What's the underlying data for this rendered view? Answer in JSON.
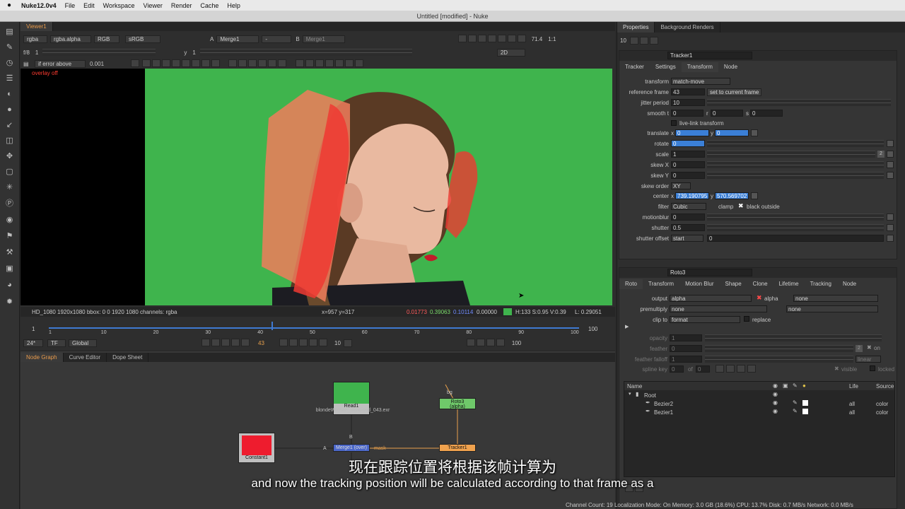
{
  "menubar": {
    "app": "Nuke12.0v4",
    "items": [
      "File",
      "Edit",
      "Workspace",
      "Viewer",
      "Render",
      "Cache",
      "Help"
    ]
  },
  "window_title": "Untitled [modified] - Nuke",
  "viewer": {
    "tab": "Viewer1",
    "channels": "rgba",
    "channel_alpha": "rgba.alpha",
    "display": "RGB",
    "colorspace": "sRGB",
    "input_a": "Merge1",
    "input_a_label": "A",
    "dash": "-",
    "input_b_label": "B",
    "input_b": "Merge1",
    "zoom": "71.4",
    "ratio": "1:1",
    "frame_label": "f/8",
    "frame_value": "1",
    "y_label": "y",
    "y_value": "1",
    "mode_2d": "2D",
    "error_mode": "if error above",
    "error_value": "0.001",
    "overlay": "overlay off",
    "status_format": "HD_1080 1920x1080  bbox: 0 0 1920 1080  channels: rgba",
    "status_xy": "x=957 y=317",
    "status_r": "0.01773",
    "status_g": "0.39063",
    "status_b": "0.10114",
    "status_a": "0.00000",
    "status_hsv": "H:133 S:0.95 V:0.39",
    "status_l": "L: 0.29051",
    "colors": {
      "green_screen": "#3fb44d",
      "roto_orange": "#e8745a",
      "roto_red": "#ee3a32"
    }
  },
  "timeline": {
    "start": "1",
    "end": "100",
    "end2": "100",
    "ticks": [
      "1",
      "10",
      "20",
      "30",
      "40",
      "50",
      "60",
      "70",
      "80",
      "90",
      "100"
    ],
    "fps": "24*",
    "tf": "TF",
    "global": "Global",
    "current_frame": "43",
    "step": "10",
    "frame_marker_fraction": 0.42
  },
  "nodegraph": {
    "tabs": [
      "Node Graph",
      "Curve Editor",
      "Dope Sheet"
    ],
    "read_label": "Read1",
    "read_file": "blondeWoman_denoised_043.exr",
    "roto_label": "Roto3",
    "roto_sub": "(alpha)",
    "merge_label": "Merge1 (over)",
    "tracker_label": "Tracker1",
    "constant_label": "Constant1",
    "pipe_a": "A",
    "pipe_b": "B",
    "pipe_mask": "mask",
    "pipe_bg": "bg"
  },
  "properties": {
    "tabs": [
      "Properties",
      "Background Renders"
    ],
    "count": "10",
    "tracker": {
      "name": "Tracker1",
      "tabs": [
        "Tracker",
        "Settings",
        "Transform",
        "Node"
      ],
      "active_tab": "Transform",
      "transform_label": "transform",
      "transform_value": "match-move",
      "ref_frame_label": "reference frame",
      "ref_frame_value": "43",
      "set_current": "set to current frame",
      "jitter_label": "jitter period",
      "jitter_value": "10",
      "smooth_label": "smooth t",
      "smooth_t": "0",
      "smooth_r_label": "r",
      "smooth_r": "0",
      "smooth_s_label": "s",
      "smooth_s": "0",
      "live_link": "live-link transform",
      "translate_label": "translate",
      "translate_x_label": "x",
      "translate_x": "0",
      "translate_y_label": "y",
      "translate_y": "0",
      "rotate_label": "rotate",
      "rotate_value": "0",
      "scale_label": "scale",
      "scale_value": "1",
      "scale_badge": "2",
      "skewx_label": "skew X",
      "skewx_value": "0",
      "skewy_label": "skew Y",
      "skewy_value": "0",
      "skew_order_label": "skew order",
      "skew_order_value": "XY",
      "center_label": "center",
      "center_x_label": "x",
      "center_x": "739.190795",
      "center_y_label": "y",
      "center_y": "570.569702",
      "filter_label": "filter",
      "filter_value": "Cubic",
      "clamp": "clamp",
      "black_outside": "black outside",
      "motionblur_label": "motionblur",
      "motionblur_value": "0",
      "shutter_label": "shutter",
      "shutter_value": "0.5",
      "shutter_offset_label": "shutter offset",
      "shutter_offset_value": "start",
      "shutter_offset_num": "0"
    },
    "roto": {
      "name": "Roto3",
      "tabs": [
        "Roto",
        "Transform",
        "Motion Blur",
        "Shape",
        "Clone",
        "Lifetime",
        "Tracking",
        "Node"
      ],
      "active_tab": "Roto",
      "output_label": "output",
      "output_value": "alpha",
      "alpha_check": "alpha",
      "output_none": "none",
      "premultiply_label": "premultiply",
      "premultiply_value": "none",
      "premultiply_none": "none",
      "clip_label": "clip to",
      "clip_value": "format",
      "replace": "replace",
      "opacity_label": "opacity",
      "opacity_value": "1",
      "feather_label": "feather",
      "feather_value": "0",
      "feather_badge": "2",
      "feather_on": "on",
      "falloff_label": "feather falloff",
      "falloff_value": "1",
      "falloff_mode": "linear",
      "splinekey_label": "spline key",
      "splinekey_value": "0",
      "splinekey_of": "of",
      "splinekey_total": "0",
      "visible": "visible",
      "locked": "locked",
      "tree_headers": {
        "name": "Name",
        "life": "Life",
        "source": "Source"
      },
      "tree_rows": [
        {
          "name": "Root",
          "life": "",
          "source": ""
        },
        {
          "name": "Bezier2",
          "life": "all",
          "source": "color"
        },
        {
          "name": "Bezier1",
          "life": "all",
          "source": "color"
        }
      ]
    }
  },
  "subtitles": {
    "cn": "现在跟踪位置将根据该帧计算为",
    "en": "and now the tracking position will be calculated according to that frame as a"
  },
  "statusbar": "Channel Count: 19  Localization Mode: On  Memory: 3.0 GB (18.6%)  CPU: 13.7%  Disk: 0.7 MB/s  Network: 0.0 MB/s"
}
